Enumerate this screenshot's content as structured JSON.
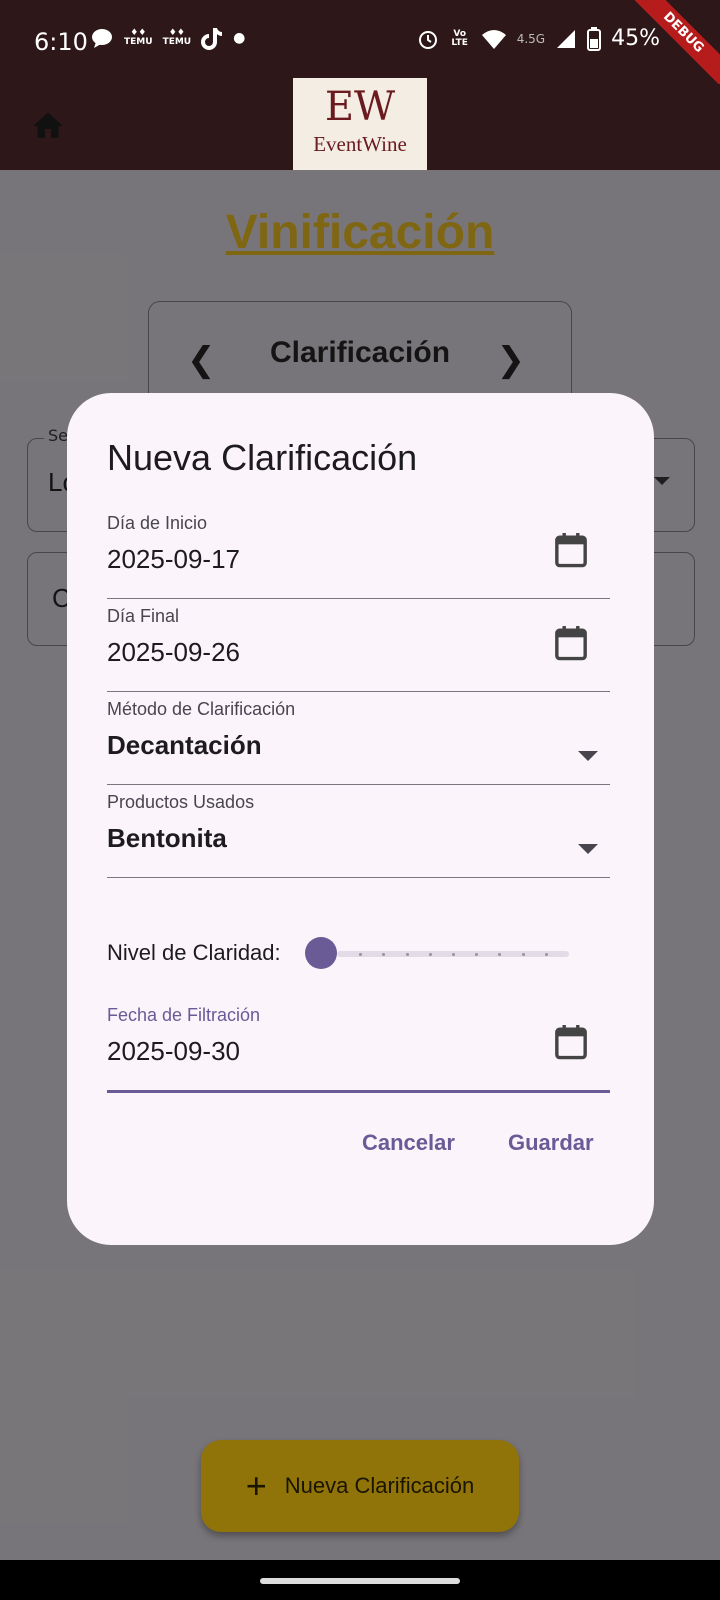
{
  "status_bar": {
    "time": "6:10",
    "battery": "45%",
    "network": "4.5G",
    "volte": "Vo LTE",
    "temu_label": "TEMU"
  },
  "app": {
    "logo_mark": "EW",
    "logo_text": "EventWine",
    "debug_banner": "DEBUG"
  },
  "page": {
    "title": "Vinificación",
    "stage": "Clarificación",
    "field1_label": "Se",
    "field1_value": "Lo",
    "field2_value": "C",
    "fab_label": "Nueva Clarificación"
  },
  "dialog": {
    "title": "Nueva Clarificación",
    "fields": [
      {
        "label": "Día de Inicio",
        "value": "2025-09-17"
      },
      {
        "label": "Día Final",
        "value": "2025-09-26"
      },
      {
        "label": "Método de Clarificación",
        "value": "Decantación"
      },
      {
        "label": "Productos Usados",
        "value": "Bentonita"
      }
    ],
    "slider_label": "Nivel de Claridad:",
    "slider_value": 0,
    "slider_divisions": 10,
    "filter_field": {
      "label": "Fecha de Filtración",
      "value": "2025-09-30"
    },
    "cancel": "Cancelar",
    "save": "Guardar"
  },
  "colors": {
    "app_bar": "#2e1719",
    "accent": "#6a5a96",
    "title_gold": "#d4ab20",
    "fab": "#f2c10f"
  }
}
